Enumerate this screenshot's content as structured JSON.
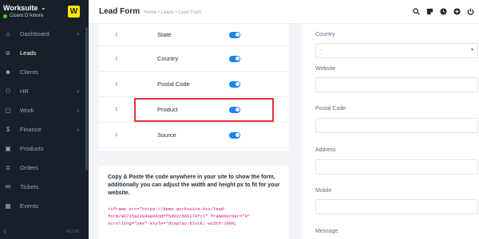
{
  "sidebar": {
    "brand": "Worksuite",
    "logo_letter": "W",
    "user": "Cicero D'Amore",
    "status_color": "#39e500",
    "version": "v5.2.80",
    "items": [
      {
        "label": "Dashboard",
        "icon": "house-icon",
        "arrow": true,
        "active": false
      },
      {
        "label": "Leads",
        "icon": "user-icon",
        "arrow": false,
        "active": true
      },
      {
        "label": "Clients",
        "icon": "users-icon",
        "arrow": false,
        "active": false
      },
      {
        "label": "HR",
        "icon": "people-icon",
        "arrow": true,
        "active": false
      },
      {
        "label": "Work",
        "icon": "briefcase-icon",
        "arrow": true,
        "active": false
      },
      {
        "label": "Finance",
        "icon": "dollar-icon",
        "arrow": true,
        "active": false
      },
      {
        "label": "Products",
        "icon": "box-icon",
        "arrow": false,
        "active": false
      },
      {
        "label": "Orders",
        "icon": "cart-icon",
        "arrow": false,
        "active": false
      },
      {
        "label": "Tickets",
        "icon": "ticket-icon",
        "arrow": false,
        "active": false
      },
      {
        "label": "Events",
        "icon": "calendar-icon",
        "arrow": false,
        "active": false
      }
    ]
  },
  "header": {
    "title": "Lead Form",
    "breadcrumb": "Home • Leads • Lead Form",
    "icons": [
      "search-icon",
      "sticky-note-icon",
      "clock-icon",
      "plus-circle-icon",
      "power-icon"
    ]
  },
  "fields": [
    {
      "label": "State",
      "enabled": true
    },
    {
      "label": "Country",
      "enabled": true
    },
    {
      "label": "Postal Code",
      "enabled": true
    },
    {
      "label": "Product",
      "enabled": true
    },
    {
      "label": "Source",
      "enabled": true
    }
  ],
  "embed": {
    "description": "Copy & Paste the code anywhere in your site to show the form, additionally you can adjust the width and height px to fit for your website.",
    "code": "<iframe src=\"https://demo.worksuite.biz/lead-\nform/90715a2284ae00ddff5d62cd65270fc7\" frameborder=\"0\"\nscrolling=\"yes\" style=\"display:block; width:100%;"
  },
  "preview": {
    "country_label": "Country",
    "country_value": "--",
    "website_label": "Website",
    "postal_label": "Postal Code",
    "address_label": "Address",
    "mobile_label": "Mobile",
    "message_label": "Message"
  },
  "colors": {
    "sidebar_bg": "#171f29",
    "toggle_on": "#1d82f5",
    "highlight": "#e8303a",
    "code_text": "#d30b6c"
  }
}
